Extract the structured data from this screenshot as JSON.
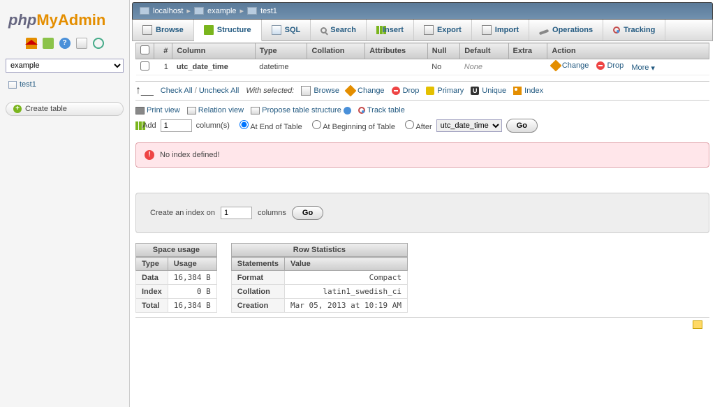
{
  "logo": {
    "php": "php",
    "my": "My",
    "admin": "Admin"
  },
  "sidebar": {
    "db_selected": "example",
    "tree": [
      "test1"
    ],
    "create_table": "Create table"
  },
  "breadcrumb": {
    "host": "localhost",
    "db": "example",
    "table": "test1"
  },
  "tabs": [
    "Browse",
    "Structure",
    "SQL",
    "Search",
    "Insert",
    "Export",
    "Import",
    "Operations",
    "Tracking"
  ],
  "cols": {
    "headers": [
      "#",
      "Column",
      "Type",
      "Collation",
      "Attributes",
      "Null",
      "Default",
      "Extra",
      "Action"
    ],
    "rows": [
      {
        "num": "1",
        "name": "utc_date_time",
        "type": "datetime",
        "collation": "",
        "attributes": "",
        "null": "No",
        "default": "None",
        "extra": ""
      }
    ],
    "actions": {
      "change": "Change",
      "drop": "Drop",
      "more": "More"
    }
  },
  "rowactions": {
    "check_all": "Check All",
    "uncheck_all": "Uncheck All",
    "with_selected": "With selected:",
    "browse": "Browse",
    "change": "Change",
    "drop": "Drop",
    "primary": "Primary",
    "unique": "Unique",
    "index": "Index"
  },
  "toolrow": {
    "print": "Print view",
    "relation": "Relation view",
    "propose": "Propose table structure",
    "track": "Track table"
  },
  "addrow": {
    "add": "Add",
    "count": "1",
    "columns": "column(s)",
    "at_end": "At End of Table",
    "at_begin": "At Beginning of Table",
    "after": "After",
    "after_col": "utc_date_time",
    "go": "Go"
  },
  "warning": "No index defined!",
  "index_panel": {
    "label_pre": "Create an index on",
    "count": "1",
    "label_post": "columns",
    "go": "Go"
  },
  "space": {
    "caption": "Space usage",
    "headers": [
      "Type",
      "Usage"
    ],
    "rows": [
      {
        "type": "Data",
        "val": "16,384",
        "unit": "B"
      },
      {
        "type": "Index",
        "val": "0",
        "unit": "B"
      },
      {
        "type": "Total",
        "val": "16,384",
        "unit": "B"
      }
    ]
  },
  "rowstats": {
    "caption": "Row Statistics",
    "headers": [
      "Statements",
      "Value"
    ],
    "rows": [
      {
        "k": "Format",
        "v": "Compact"
      },
      {
        "k": "Collation",
        "v": "latin1_swedish_ci"
      },
      {
        "k": "Creation",
        "v": "Mar 05, 2013 at 10:19 AM"
      }
    ]
  }
}
